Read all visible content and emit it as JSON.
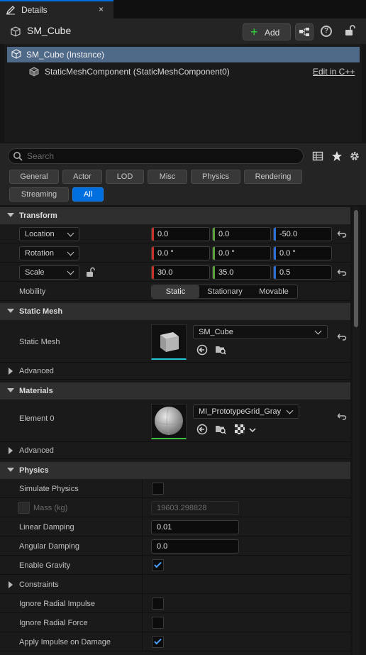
{
  "tab": {
    "title": "Details",
    "close": "×"
  },
  "header": {
    "actor_name": "SM_Cube",
    "add_label": "Add",
    "add_symbol": "+"
  },
  "tree": {
    "instance_label": "SM_Cube (Instance)",
    "component_label": "StaticMeshComponent (StaticMeshComponent0)",
    "edit_link": "Edit in C++"
  },
  "search": {
    "placeholder": "Search"
  },
  "filters": [
    "General",
    "Actor",
    "LOD",
    "Misc",
    "Physics",
    "Rendering",
    "Streaming",
    "All"
  ],
  "filters_active": "All",
  "transform": {
    "header": "Transform",
    "location": {
      "label": "Location",
      "x": "0.0",
      "y": "0.0",
      "z": "-50.0"
    },
    "rotation": {
      "label": "Rotation",
      "x": "0.0 °",
      "y": "0.0 °",
      "z": "0.0 °"
    },
    "scale": {
      "label": "Scale",
      "x": "30.0",
      "y": "35.0",
      "z": "0.5"
    },
    "mobility": {
      "label": "Mobility",
      "options": [
        "Static",
        "Stationary",
        "Movable"
      ],
      "selected": "Static"
    }
  },
  "static_mesh": {
    "header": "Static Mesh",
    "label": "Static Mesh",
    "asset": "SM_Cube",
    "advanced": "Advanced"
  },
  "materials": {
    "header": "Materials",
    "label": "Element 0",
    "asset": "MI_PrototypeGrid_Gray",
    "advanced": "Advanced"
  },
  "physics": {
    "header": "Physics",
    "simulate_physics": {
      "label": "Simulate Physics",
      "checked": false
    },
    "mass": {
      "label": "Mass (kg)",
      "value": "19603.298828"
    },
    "linear_damping": {
      "label": "Linear Damping",
      "value": "0.01"
    },
    "angular_damping": {
      "label": "Angular Damping",
      "value": "0.0"
    },
    "enable_gravity": {
      "label": "Enable Gravity",
      "checked": true
    },
    "constraints": "Constraints",
    "ignore_radial_impulse": {
      "label": "Ignore Radial Impulse",
      "checked": false
    },
    "ignore_radial_force": {
      "label": "Ignore Radial Force",
      "checked": false
    },
    "apply_impulse_on_damage": {
      "label": "Apply Impulse on Damage",
      "checked": true
    }
  },
  "colors": {
    "accent": "#0070e0",
    "x_axis": "#c83228",
    "y_axis": "#5aa03c",
    "z_axis": "#2d6fd6",
    "add_plus": "#2ed13a",
    "selection": "#4f6a88"
  }
}
